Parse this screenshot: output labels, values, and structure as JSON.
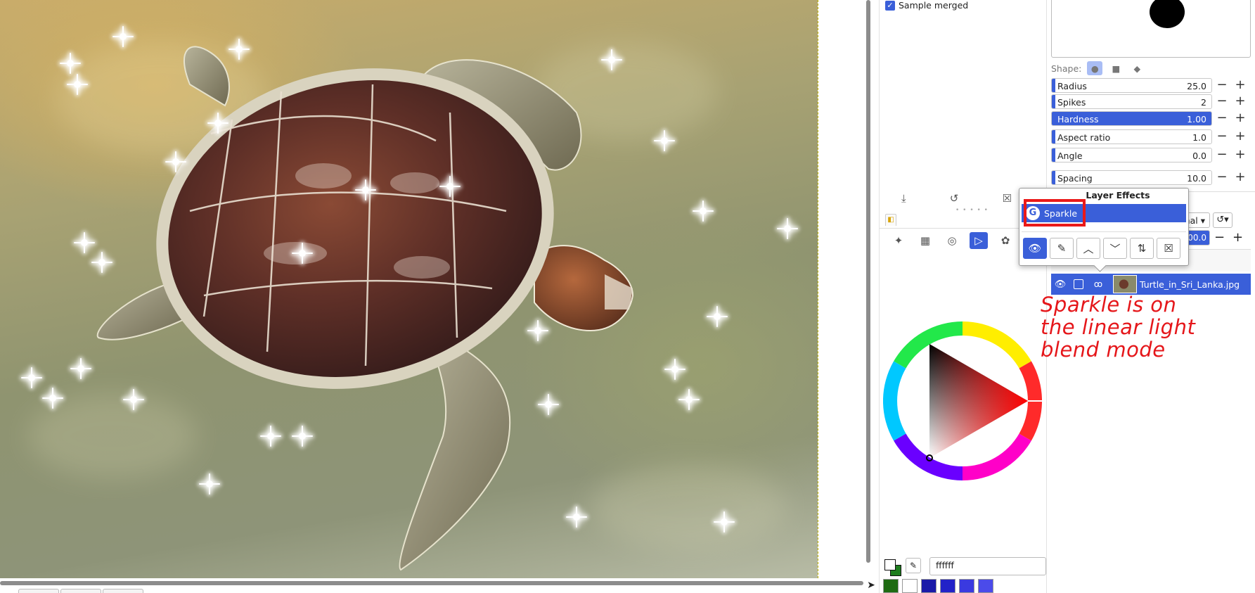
{
  "tool_options": {
    "sample_merged_label": "Sample merged",
    "sample_merged_checked": true
  },
  "brush_editor": {
    "shape_label": "Shape:",
    "shapes": [
      "circle-icon",
      "square-icon",
      "diamond-icon"
    ],
    "params": [
      {
        "label": "Radius",
        "value": "25.0",
        "fraction": 0.02
      },
      {
        "label": "Spikes",
        "value": "2",
        "fraction": 0.02
      },
      {
        "label": "Hardness",
        "value": "1.00",
        "fraction": 1.0
      },
      {
        "label": "Aspect ratio",
        "value": "1.0",
        "fraction": 0.02
      },
      {
        "label": "Angle",
        "value": "0.0",
        "fraction": 0.02
      },
      {
        "label": "Spacing",
        "value": "10.0",
        "fraction": 0.02
      }
    ],
    "minus_symbol": "−",
    "plus_symbol": "+"
  },
  "layers": {
    "mode_value": "rmal",
    "opacity_value": "00.0",
    "items": [
      {
        "name": "Turtle_in_Sri_Lanka.jpg",
        "visible": true,
        "selected": true
      }
    ]
  },
  "layer_effects_popup": {
    "title": "Layer Effects",
    "effects": [
      {
        "name": "Sparkle",
        "icon": "gegl-icon",
        "icon_glyph": "G"
      }
    ],
    "toolbar_icons": [
      "eye-icon",
      "edit-icon",
      "raise-icon",
      "lower-icon",
      "merge-icon",
      "delete-icon"
    ]
  },
  "color_dock": {
    "hex_value": "ffffff",
    "foreground": "#ffffff",
    "background": "#1e7d1e",
    "swatches": [
      "#1e6b12",
      "#ffffff",
      "#1a1aa8",
      "#2222c8",
      "#3a3ae0",
      "#4b4bea"
    ]
  },
  "annotation": {
    "lines": [
      "Sparkle is on",
      "the linear light",
      " blend mode"
    ],
    "color": "#e5161a"
  },
  "colors": {
    "accent": "#3a5fd9",
    "highlight": "#ea1919"
  }
}
